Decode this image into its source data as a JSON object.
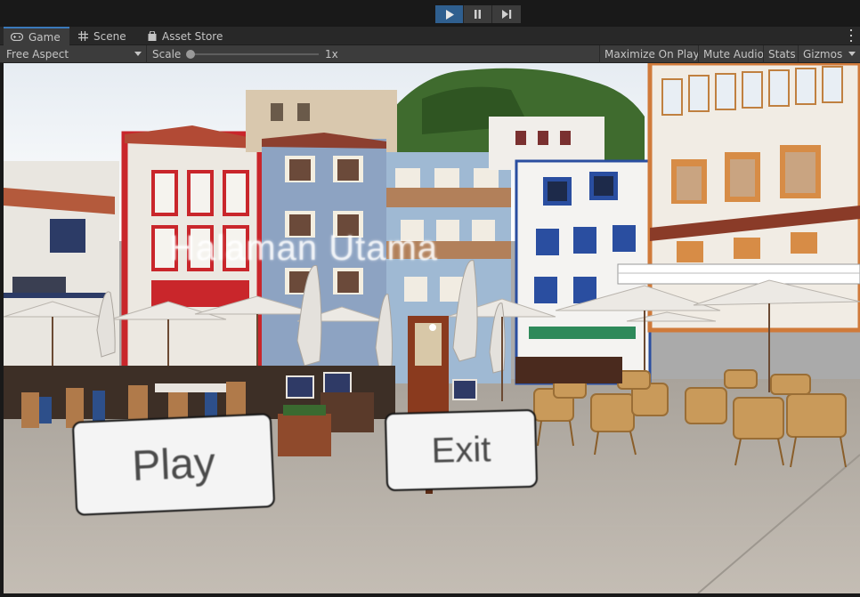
{
  "play_controls": {
    "play_icon": "play-icon",
    "pause_icon": "pause-icon",
    "step_icon": "step-icon"
  },
  "tabs": [
    {
      "label": "Game",
      "icon": "gamepad-icon",
      "active": true
    },
    {
      "label": "Scene",
      "icon": "grid-icon",
      "active": false
    },
    {
      "label": "Asset Store",
      "icon": "bag-icon",
      "active": false
    }
  ],
  "game_toolbar": {
    "aspect": "Free Aspect",
    "scale_label": "Scale",
    "scale_value": "1x",
    "maximize": "Maximize On Play",
    "mute": "Mute Audio",
    "stats": "Stats",
    "gizmos": "Gizmos"
  },
  "game_view": {
    "title": "Halaman Utama",
    "play_button": "Play",
    "exit_button": "Exit"
  },
  "colors": {
    "active_play": "#2f5f8f",
    "panel": "#3c3c3c",
    "tab_accent": "#3a79bb"
  }
}
